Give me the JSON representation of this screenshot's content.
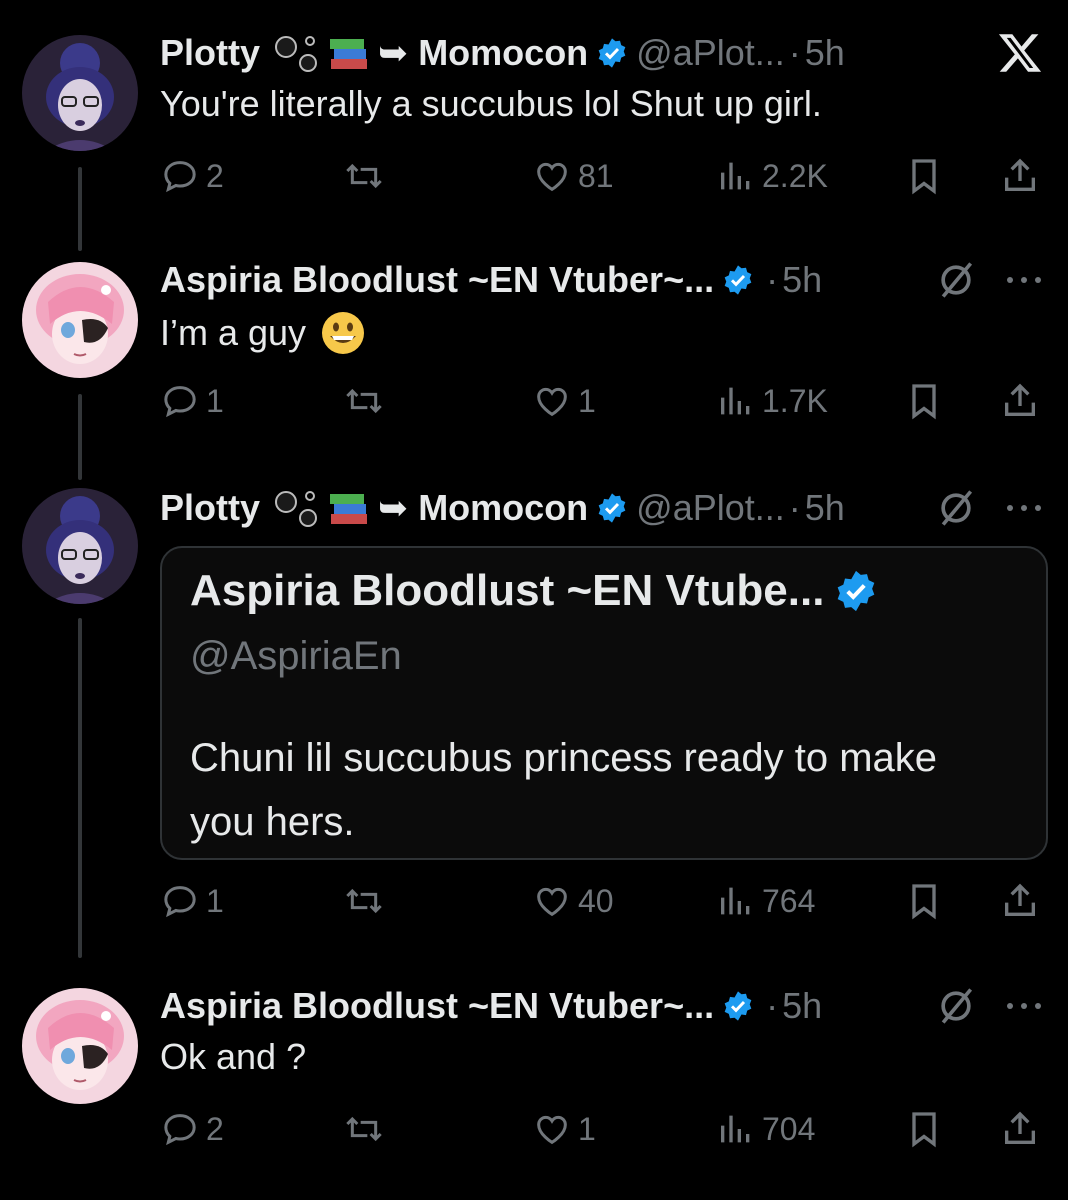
{
  "tweets": [
    {
      "name": "Plotty",
      "arrow": "➥",
      "name2": "Momocon",
      "handle": "@aPlot...",
      "dot": "·",
      "time": "5h",
      "text": "You're literally a succubus lol Shut up girl.",
      "replies": "2",
      "retweets": "",
      "likes": "81",
      "views": "2.2K",
      "top_icon": "x-logo-icon"
    },
    {
      "name": "Aspiria Bloodlust ~EN Vtuber~...",
      "dot": "·",
      "time": "5h",
      "text": "I’m a guy",
      "replies": "1",
      "retweets": "",
      "likes": "1",
      "views": "1.7K",
      "top_icon": "grok-icon"
    },
    {
      "name": "Plotty",
      "arrow": "➥",
      "name2": "Momocon",
      "handle": "@aPlot...",
      "dot": "·",
      "time": "5h",
      "quote": {
        "name": "Aspiria Bloodlust ~EN Vtube...",
        "handle": "@AspiriaEn",
        "text": "Chuni lil succubus princess ready to make you hers."
      },
      "replies": "1",
      "retweets": "",
      "likes": "40",
      "views": "764",
      "top_icon": "grok-icon"
    },
    {
      "name": "Aspiria Bloodlust ~EN Vtuber~...",
      "dot": "·",
      "time": "5h",
      "text": "Ok and ?",
      "replies": "2",
      "retweets": "",
      "likes": "1",
      "views": "704",
      "top_icon": "grok-icon"
    }
  ],
  "colors": {
    "background": "#000000",
    "text": "#e7e9ea",
    "muted": "#71767b",
    "verified": "#1d9bf0",
    "thread_line": "#333639"
  }
}
